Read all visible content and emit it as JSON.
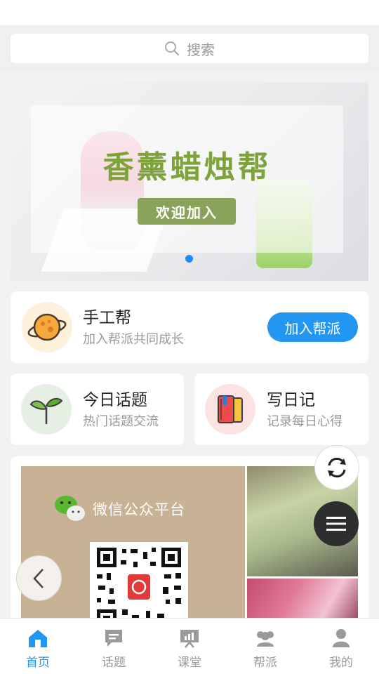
{
  "search": {
    "placeholder": "搜索"
  },
  "banner": {
    "title": "香薰蜡烛帮",
    "badge": "欢迎加入"
  },
  "group_card": {
    "name": "手工帮",
    "subtitle": "加入帮派共同成长",
    "join_label": "加入帮派"
  },
  "topics_card": {
    "title": "今日话题",
    "subtitle": "热门话题交流"
  },
  "diary_card": {
    "title": "写日记",
    "subtitle": "记录每日心得"
  },
  "promo": {
    "wechat_label": "微信公众平台"
  },
  "tabs": [
    {
      "label": "首页",
      "icon": "home-icon",
      "active": true
    },
    {
      "label": "话题",
      "icon": "chat-icon",
      "active": false
    },
    {
      "label": "课堂",
      "icon": "classroom-icon",
      "active": false
    },
    {
      "label": "帮派",
      "icon": "group-icon",
      "active": false
    },
    {
      "label": "我的",
      "icon": "user-icon",
      "active": false
    }
  ],
  "colors": {
    "accent": "#2196f3",
    "banner_green": "#7da33a",
    "badge_green": "#8aa35b"
  }
}
